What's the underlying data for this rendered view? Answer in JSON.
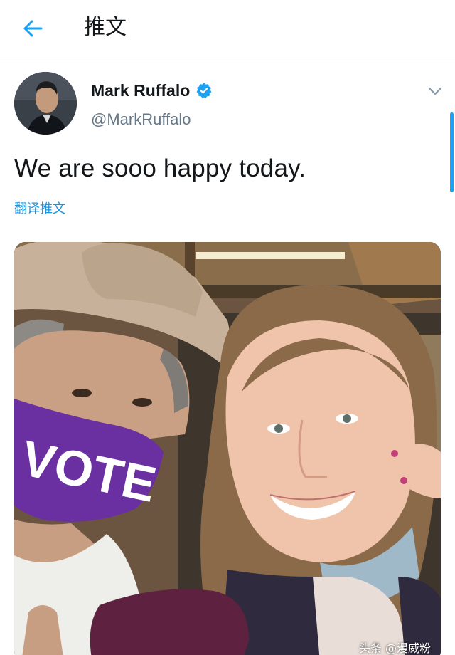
{
  "header": {
    "back_icon": "arrow-left-icon",
    "title": "推文"
  },
  "tweet": {
    "author": {
      "display_name": "Mark Ruffalo",
      "handle": "@MarkRuffalo",
      "verified": true,
      "verified_color": "#1da1f2"
    },
    "text": "We are sooo happy today.",
    "translate_label": "翻译推文",
    "photo": {
      "mask_text": "VOTE",
      "mask_color": "#6a2fa0"
    }
  },
  "watermark": "头条 @漫威粉",
  "colors": {
    "accent": "#1da1f2",
    "link": "#1b95e0",
    "secondary_text": "#657786",
    "divider": "#e6ecf0"
  }
}
